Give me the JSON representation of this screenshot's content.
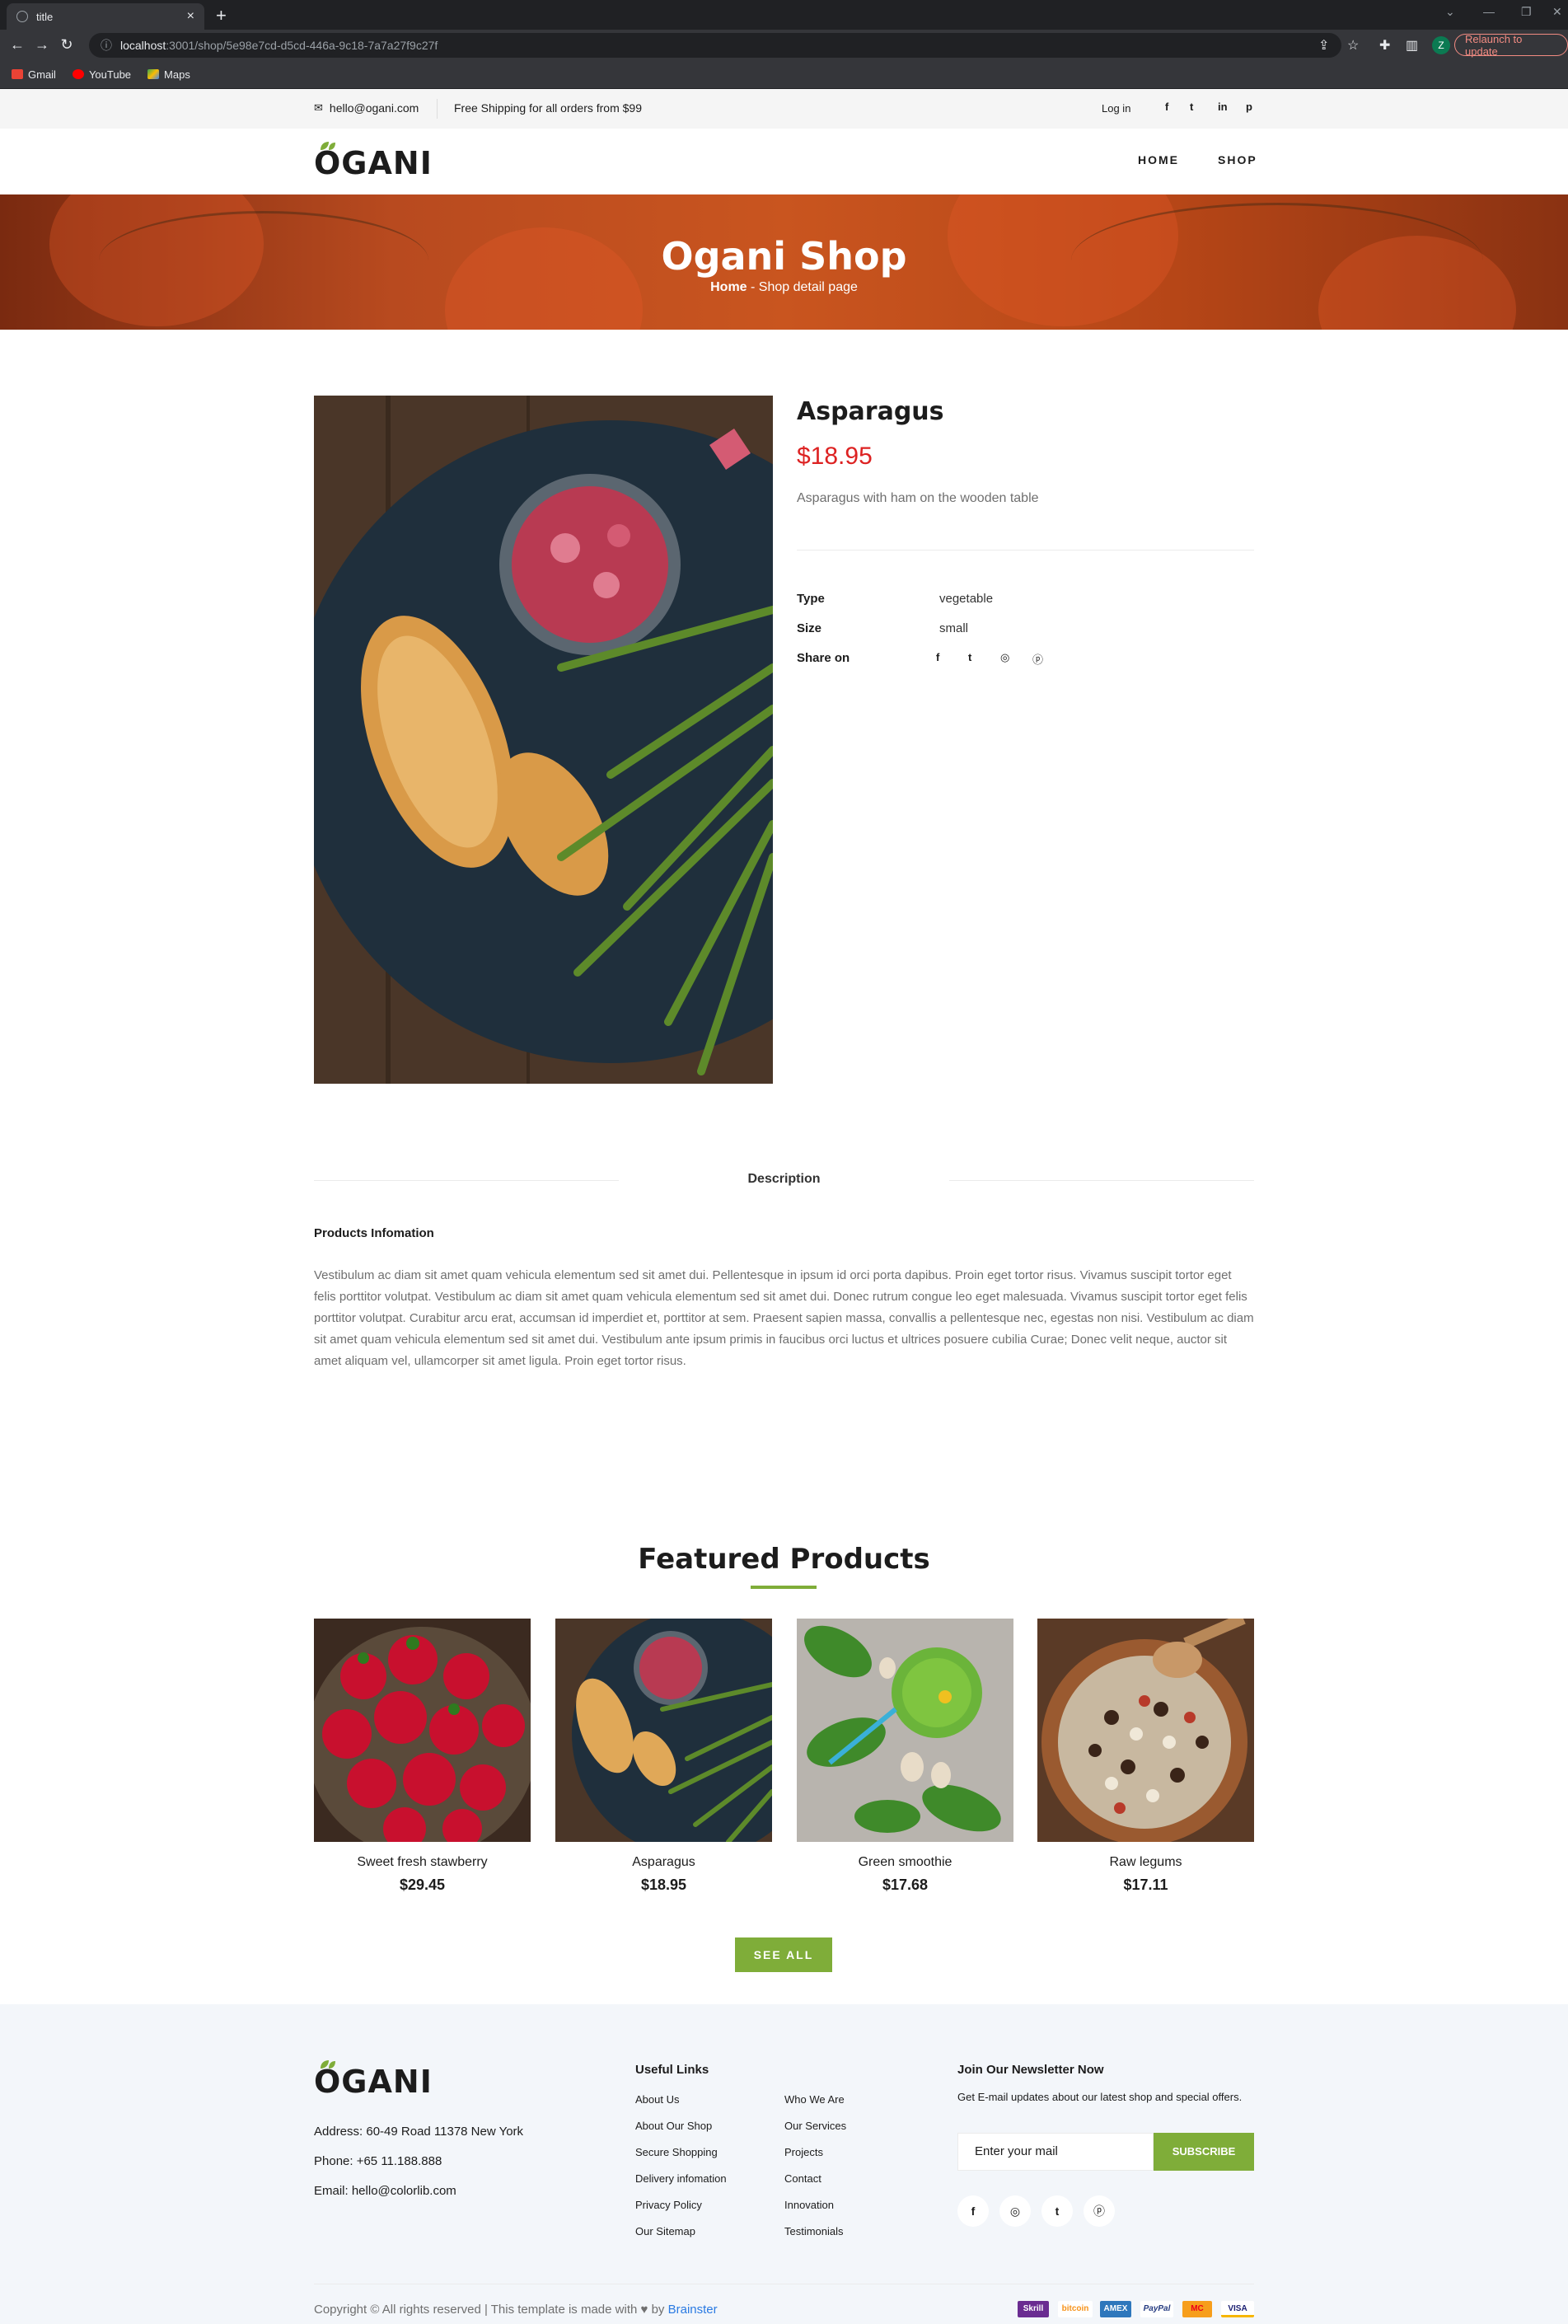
{
  "browser": {
    "tab_title": "title",
    "url_host": "localhost",
    "url_path": ":3001/shop/5e98e7cd-d5cd-446a-9c18-7a7a27f9c27f",
    "relaunch_label": "Relaunch to update",
    "profile_initial": "Z",
    "bookmarks": [
      "Gmail",
      "YouTube",
      "Maps"
    ]
  },
  "topbar": {
    "email": "hello@ogani.com",
    "shipping": "Free Shipping for all orders from $99",
    "login": "Log in",
    "social": [
      "f",
      "t",
      "in",
      "p"
    ]
  },
  "header": {
    "logo": "OGANI",
    "menu": [
      "HOME",
      "SHOP"
    ]
  },
  "hero": {
    "title": "Ogani Shop",
    "crumb_home": "Home",
    "crumb_sep": " - ",
    "crumb_current": "Shop detail page"
  },
  "product": {
    "name": "Asparagus",
    "price": "$18.95",
    "description": "Asparagus with ham on the wooden table",
    "specs": [
      {
        "key": "Type",
        "value": "vegetable"
      },
      {
        "key": "Size",
        "value": "small"
      }
    ],
    "share_label": "Share on"
  },
  "details": {
    "tab_label": "Description",
    "info_title": "Products Infomation",
    "paragraph": "Vestibulum ac diam sit amet quam vehicula elementum sed sit amet dui. Pellentesque in ipsum id orci porta dapibus. Proin eget tortor risus. Vivamus suscipit tortor eget felis porttitor volutpat. Vestibulum ac diam sit amet quam vehicula elementum sed sit amet dui. Donec rutrum congue leo eget malesuada. Vivamus suscipit tortor eget felis porttitor volutpat. Curabitur arcu erat, accumsan id imperdiet et, porttitor at sem. Praesent sapien massa, convallis a pellentesque nec, egestas non nisi. Vestibulum ac diam sit amet quam vehicula elementum sed sit amet dui. Vestibulum ante ipsum primis in faucibus orci luctus et ultrices posuere cubilia Curae; Donec velit neque, auctor sit amet aliquam vel, ullamcorper sit amet ligula. Proin eget tortor risus."
  },
  "featured": {
    "title": "Featured Products",
    "items": [
      {
        "name": "Sweet fresh stawberry",
        "price": "$29.45"
      },
      {
        "name": "Asparagus",
        "price": "$18.95"
      },
      {
        "name": "Green smoothie",
        "price": "$17.68"
      },
      {
        "name": "Raw legums",
        "price": "$17.11"
      }
    ],
    "see_all": "SEE ALL"
  },
  "footer": {
    "logo": "OGANI",
    "address": "Address: 60-49 Road 11378 New York",
    "phone": "Phone: +65 11.188.888",
    "email": "Email: hello@colorlib.com",
    "links_title": "Useful Links",
    "links_col1": [
      "About Us",
      "About Our Shop",
      "Secure Shopping",
      "Delivery infomation",
      "Privacy Policy",
      "Our Sitemap"
    ],
    "links_col2": [
      "Who We Are",
      "Our Services",
      "Projects",
      "Contact",
      "Innovation",
      "Testimonials"
    ],
    "newsletter_title": "Join Our Newsletter Now",
    "newsletter_text": "Get E-mail updates about our latest shop and special offers.",
    "newsletter_placeholder": "Enter your mail",
    "subscribe": "SUBSCRIBE",
    "copyright": "Copyright © All rights reserved | This template is made with",
    "copyright_by": "by",
    "brand": "Brainster",
    "payments": [
      "Skrill",
      "bitcoin",
      "AMEX",
      "PayPal",
      "MC",
      "VISA"
    ]
  },
  "colors": {
    "accent": "#7fad39",
    "price": "#dd2222"
  }
}
